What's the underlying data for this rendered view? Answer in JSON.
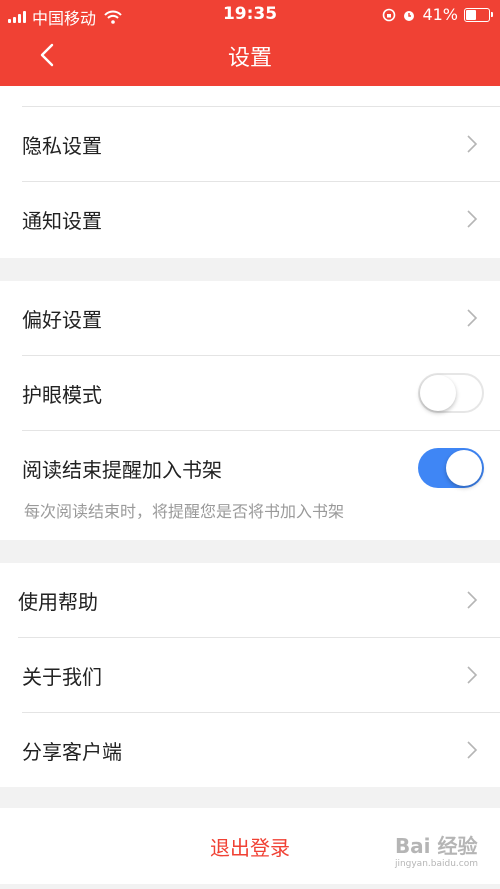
{
  "status_bar": {
    "carrier": "中国移动",
    "time": "19:35",
    "battery": "41%"
  },
  "header": {
    "title": "设置"
  },
  "settings": {
    "privacy": "隐私设置",
    "notification": "通知设置",
    "preference": "偏好设置",
    "eye_protection": {
      "label": "护眼模式",
      "enabled": false
    },
    "reading_end_reminder": {
      "label": "阅读结束提醒加入书架",
      "enabled": true,
      "hint": "每次阅读结束时，将提醒您是否将书加入书架"
    },
    "help": "使用帮助",
    "about": "关于我们",
    "share": "分享客户端"
  },
  "logout_label": "退出登录",
  "watermark": {
    "text": "Bai 经验",
    "url": "jingyan.baidu.com"
  },
  "colors": {
    "accent": "#f04134",
    "toggle_on": "#3f86f5"
  }
}
